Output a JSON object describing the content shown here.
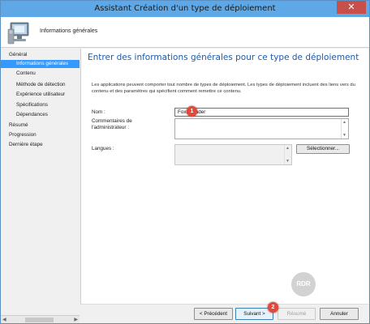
{
  "window": {
    "title": "Assistant Création d'un type de déploiement",
    "close_label": "✕"
  },
  "header": {
    "title": "Informations générales",
    "icon": "computer-monitor-icon"
  },
  "nav": {
    "items": [
      {
        "label": "Général",
        "level": "top",
        "selected": false
      },
      {
        "label": "Informations générales",
        "level": "sub",
        "selected": true
      },
      {
        "label": "Contenu",
        "level": "sub",
        "selected": false
      },
      {
        "label": "Méthode de détection",
        "level": "sub",
        "selected": false
      },
      {
        "label": "Expérience utilisateur",
        "level": "sub",
        "selected": false
      },
      {
        "label": "Spécifications",
        "level": "sub",
        "selected": false
      },
      {
        "label": "Dépendances",
        "level": "sub",
        "selected": false
      },
      {
        "label": "Résumé",
        "level": "top",
        "selected": false
      },
      {
        "label": "Progression",
        "level": "top",
        "selected": false
      },
      {
        "label": "Dernière étape",
        "level": "top",
        "selected": false
      }
    ],
    "scroll_thumb": "III"
  },
  "content": {
    "title": "Entrer des informations générales pour ce type de déploiement",
    "description": "Les applications peuvent comporter tout nombre de types de déploiement. Les types de déploiement incluent des liens vers du contenu et des paramètres qui spécifient comment remettre ce contenu.",
    "name_label": "Nom :",
    "name_value": "FoxitReader",
    "comments_label": "Commentaires de l'administrateur :",
    "comments_value": "",
    "languages_label": "Langues :",
    "select_button": "Sélectionner..."
  },
  "footer": {
    "prev": "< Précédent",
    "next": "Suivant >",
    "summary": "Résumé",
    "cancel": "Annuler"
  },
  "markers": {
    "one": "1",
    "two": "2"
  },
  "watermark": "RDR",
  "colors": {
    "titlebar": "#5ea8e8",
    "selected": "#3399ff",
    "content_title": "#1e5aa8",
    "marker": "#e04a3a",
    "close": "#c7504b"
  }
}
